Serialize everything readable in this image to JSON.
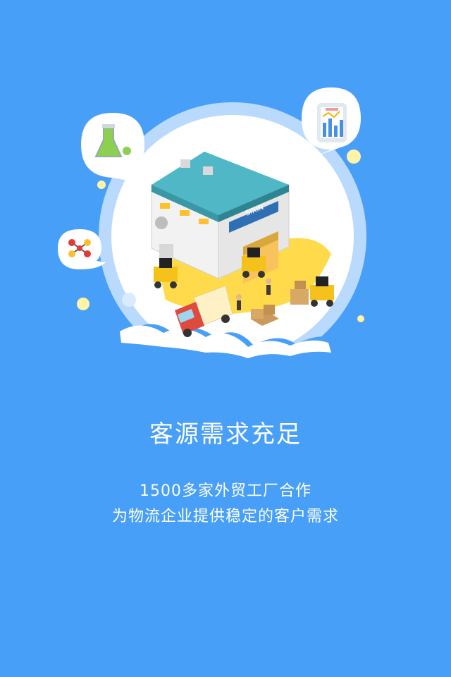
{
  "background_color": "#489ff7",
  "illustration": {
    "logo_text": "SIXIN",
    "icons": [
      "flask-icon",
      "bar-chart-phone-icon",
      "molecule-icon"
    ]
  },
  "headline": "客源需求充足",
  "description": {
    "line1": "1500多家外贸工厂合作",
    "line2": "为物流企业提供稳定的客户需求"
  }
}
